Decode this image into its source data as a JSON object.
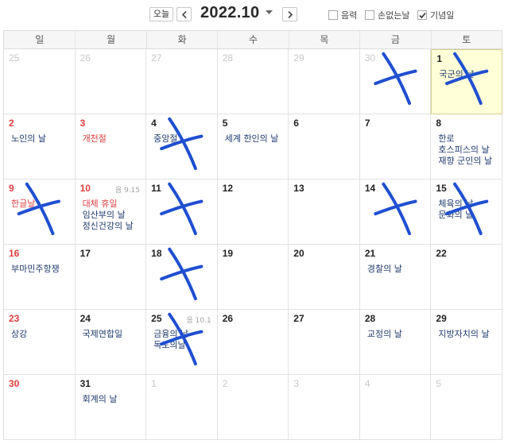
{
  "toolbar": {
    "today_label": "오늘",
    "month_title": "2022.10",
    "checkboxes": [
      {
        "label": "음력",
        "checked": false
      },
      {
        "label": "손없는날",
        "checked": false
      },
      {
        "label": "기념일",
        "checked": true
      }
    ]
  },
  "weekdays": [
    "일",
    "월",
    "화",
    "수",
    "목",
    "금",
    "토"
  ],
  "weeks": [
    [
      {
        "day": "25",
        "other": true
      },
      {
        "day": "26",
        "other": true
      },
      {
        "day": "27",
        "other": true
      },
      {
        "day": "28",
        "other": true
      },
      {
        "day": "29",
        "other": true
      },
      {
        "day": "30",
        "other": true,
        "crossed": true
      },
      {
        "day": "1",
        "today": true,
        "events": [
          "국군의 날"
        ],
        "crossed": true
      }
    ],
    [
      {
        "day": "2",
        "red": true,
        "events": [
          "노인의 날"
        ]
      },
      {
        "day": "3",
        "red": true,
        "events": [
          "개천절"
        ],
        "red_events": true
      },
      {
        "day": "4",
        "events": [
          "중앙절"
        ],
        "crossed": true
      },
      {
        "day": "5",
        "events": [
          "세계 한인의 날"
        ]
      },
      {
        "day": "6"
      },
      {
        "day": "7"
      },
      {
        "day": "8",
        "events": [
          "한로",
          "호스피스의 날",
          "재향 군인의 날"
        ]
      }
    ],
    [
      {
        "day": "9",
        "red": true,
        "events": [
          "한글날"
        ],
        "red_events": true,
        "crossed": true
      },
      {
        "day": "10",
        "red": true,
        "lunar": "음 9.15",
        "events": [
          "대체 휴일",
          "임산부의 날",
          "정신건강의 날"
        ],
        "red_first": true
      },
      {
        "day": "11",
        "crossed": true
      },
      {
        "day": "12"
      },
      {
        "day": "13"
      },
      {
        "day": "14",
        "crossed": true
      },
      {
        "day": "15",
        "events": [
          "체육의 날",
          "문화의 날"
        ],
        "crossed": true
      }
    ],
    [
      {
        "day": "16",
        "red": true,
        "events": [
          "부마민주항쟁"
        ]
      },
      {
        "day": "17"
      },
      {
        "day": "18",
        "crossed": true
      },
      {
        "day": "19"
      },
      {
        "day": "20"
      },
      {
        "day": "21",
        "events": [
          "경찰의 날"
        ]
      },
      {
        "day": "22"
      }
    ],
    [
      {
        "day": "23",
        "red": true,
        "events": [
          "상강"
        ]
      },
      {
        "day": "24",
        "events": [
          "국제연합일"
        ]
      },
      {
        "day": "25",
        "lunar": "음 10.1",
        "events": [
          "금융의 날",
          "독도의날"
        ],
        "crossed": true
      },
      {
        "day": "26"
      },
      {
        "day": "27"
      },
      {
        "day": "28",
        "events": [
          "교정의 날"
        ]
      },
      {
        "day": "29",
        "events": [
          "지방자치의 날"
        ]
      }
    ],
    [
      {
        "day": "30",
        "red": true
      },
      {
        "day": "31",
        "events": [
          "회계의 날"
        ]
      },
      {
        "day": "1",
        "other": true
      },
      {
        "day": "2",
        "other": true
      },
      {
        "day": "3",
        "other": true
      },
      {
        "day": "4",
        "other": true
      },
      {
        "day": "5",
        "other": true
      }
    ]
  ],
  "colors": {
    "accent_red": "#e04040",
    "event_blue": "#1f3a6e",
    "marker_blue": "#1f4fd1",
    "today_bg": "#ffffd8"
  }
}
